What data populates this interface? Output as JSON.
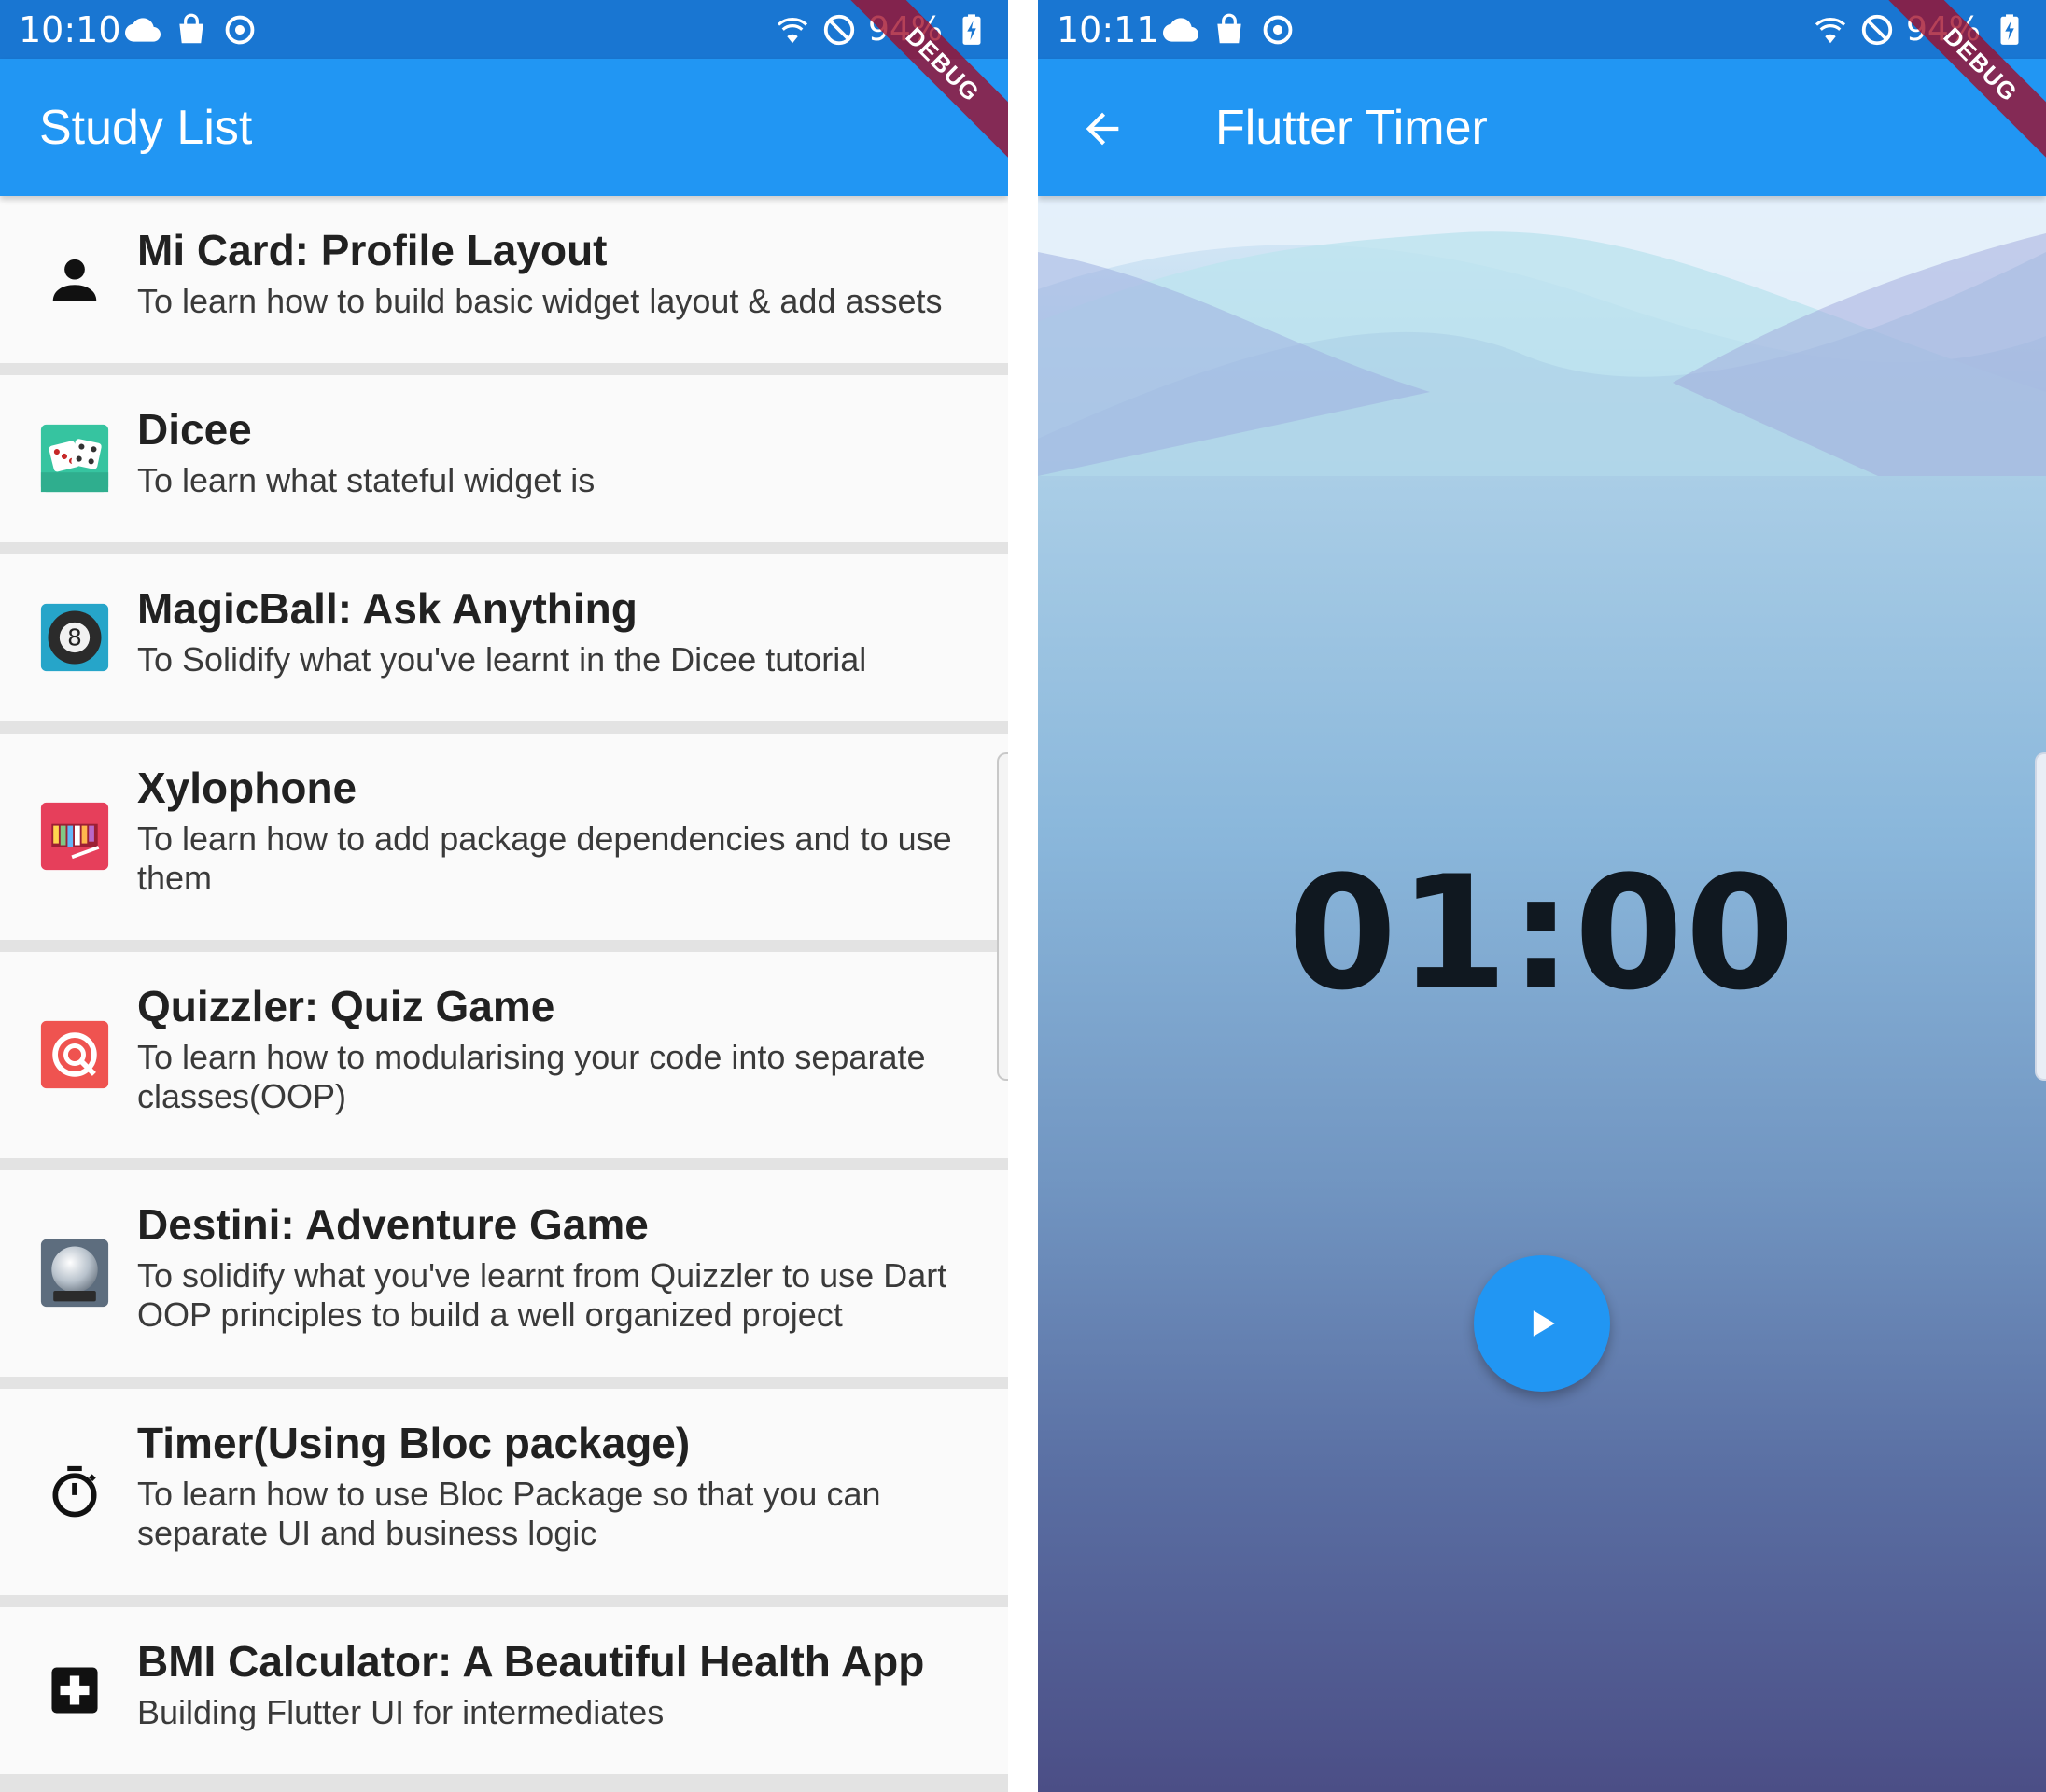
{
  "left_screen": {
    "status_bar": {
      "time": "10:10",
      "battery": "94%",
      "left_icons": [
        "cloud-icon",
        "bag-icon",
        "sync-icon"
      ],
      "right_icons": [
        "wifi-icon",
        "do-not-disturb-icon",
        "battery-charging-icon"
      ]
    },
    "app_bar": {
      "title": "Study List"
    },
    "debug_banner": "DEBUG",
    "items": [
      {
        "icon": "person-icon",
        "title": "Mi Card: Profile Layout",
        "subtitle": "To learn how to build basic widget layout & add assets"
      },
      {
        "icon": "dice-icon",
        "title": "Dicee",
        "subtitle": "To learn what stateful widget is"
      },
      {
        "icon": "magic-8-ball-icon",
        "title": "MagicBall: Ask Anything",
        "subtitle": "To Solidify what you've learnt in the Dicee tutorial"
      },
      {
        "icon": "xylophone-icon",
        "title": "Xylophone",
        "subtitle": "To learn how to add package dependencies and to use them"
      },
      {
        "icon": "quiz-icon",
        "title": "Quizzler: Quiz Game",
        "subtitle": "To learn how to modularising your code into separate classes(OOP)"
      },
      {
        "icon": "crystal-ball-icon",
        "title": "Destini: Adventure Game",
        "subtitle": "To solidify what you've learnt from Quizzler to use Dart OOP principles to build a well organized project"
      },
      {
        "icon": "stopwatch-icon",
        "title": "Timer(Using Bloc package)",
        "subtitle": "To learn how to use Bloc Package so that you can separate UI and business logic"
      },
      {
        "icon": "medical-cross-icon",
        "title": "BMI Calculator: A Beautiful Health App",
        "subtitle": "Building Flutter UI for intermediates"
      }
    ]
  },
  "right_screen": {
    "status_bar": {
      "time": "10:11",
      "battery": "94%",
      "left_icons": [
        "cloud-icon",
        "bag-icon",
        "sync-icon"
      ],
      "right_icons": [
        "wifi-icon",
        "do-not-disturb-icon",
        "battery-charging-icon"
      ]
    },
    "app_bar": {
      "title": "Flutter Timer",
      "back_icon": "back-arrow-icon"
    },
    "debug_banner": "DEBUG",
    "timer": {
      "display": "01:00"
    },
    "play_button_icon": "play-icon"
  },
  "colors": {
    "status_bar": "#1976d2",
    "app_bar": "#2196f3",
    "accent": "#2196f3",
    "list_background": "#fafafa",
    "divider": "#e3e3e3"
  }
}
